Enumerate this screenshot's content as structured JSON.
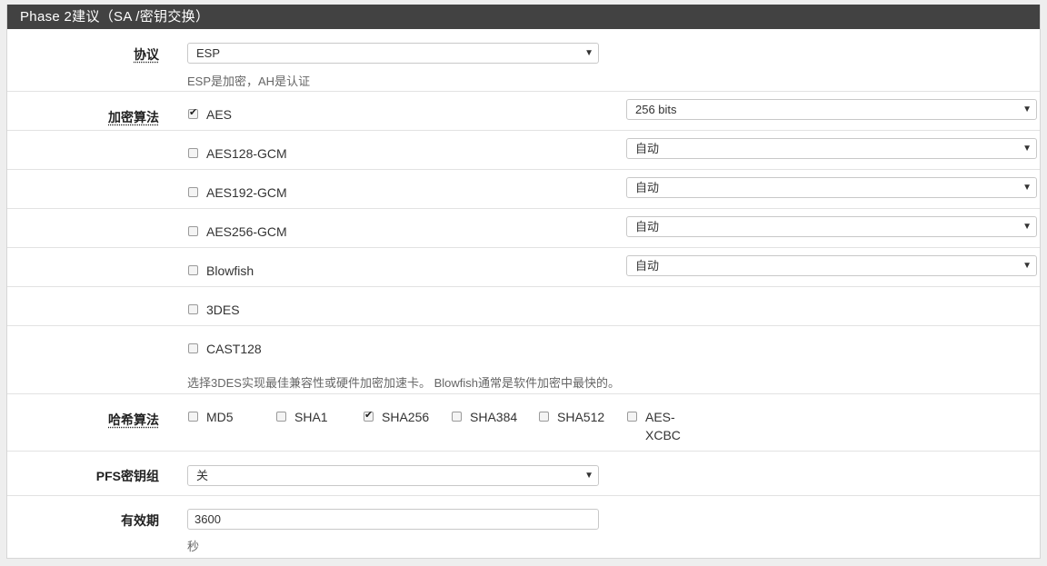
{
  "panel": {
    "title": "Phase 2建议（SA /密钥交换）"
  },
  "protocol": {
    "label": "协议",
    "value": "ESP",
    "help": "ESP是加密，AH是认证"
  },
  "encryption": {
    "label": "加密算法",
    "items": [
      {
        "name": "AES",
        "checked": true,
        "key_length": "256 bits"
      },
      {
        "name": "AES128-GCM",
        "checked": false,
        "key_length": "自动"
      },
      {
        "name": "AES192-GCM",
        "checked": false,
        "key_length": "自动"
      },
      {
        "name": "AES256-GCM",
        "checked": false,
        "key_length": "自动"
      },
      {
        "name": "Blowfish",
        "checked": false,
        "key_length": "自动"
      },
      {
        "name": "3DES",
        "checked": false
      },
      {
        "name": "CAST128",
        "checked": false
      }
    ],
    "help": "选择3DES实现最佳兼容性或硬件加密加速卡。 Blowfish通常是软件加密中最快的。"
  },
  "hash": {
    "label": "哈希算法",
    "items": [
      {
        "name": "MD5",
        "checked": false
      },
      {
        "name": "SHA1",
        "checked": false
      },
      {
        "name": "SHA256",
        "checked": true
      },
      {
        "name": "SHA384",
        "checked": false
      },
      {
        "name": "SHA512",
        "checked": false
      },
      {
        "name_line1": "AES-",
        "name_line2": "XCBC",
        "checked": false
      }
    ]
  },
  "pfs": {
    "label": "PFS密钥组",
    "value": "关"
  },
  "lifetime": {
    "label": "有效期",
    "value": "3600",
    "help": "秒"
  },
  "icons": {
    "caret": "caret-down-icon",
    "check": "check-icon"
  }
}
